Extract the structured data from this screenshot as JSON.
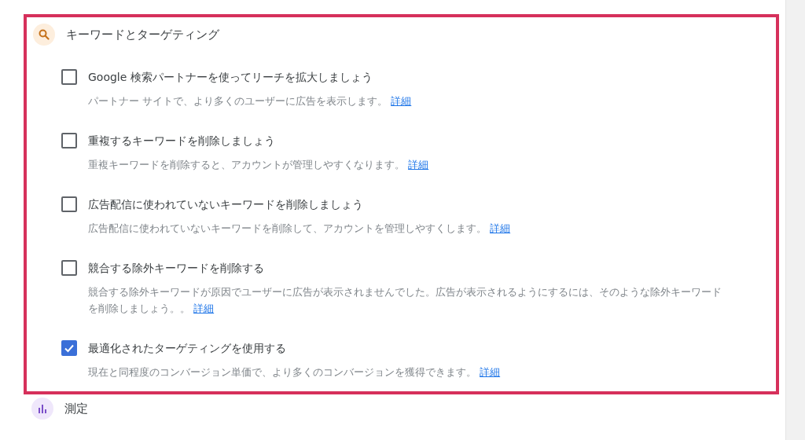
{
  "section": {
    "title": "キーワードとターゲティング"
  },
  "items": [
    {
      "title": "Google 検索パートナーを使ってリーチを拡大しましょう",
      "description": "パートナー サイトで、より多くのユーザーに広告を表示します。",
      "link": "詳細",
      "checked": false
    },
    {
      "title": "重複するキーワードを削除しましょう",
      "description": "重複キーワードを削除すると、アカウントが管理しやすくなります。",
      "link": "詳細",
      "checked": false
    },
    {
      "title": "広告配信に使われていないキーワードを削除しましょう",
      "description": "広告配信に使われていないキーワードを削除して、アカウントを管理しやすくします。",
      "link": "詳細",
      "checked": false
    },
    {
      "title": "競合する除外キーワードを削除する",
      "description": "競合する除外キーワードが原因でユーザーに広告が表示されませんでした。広告が表示されるようにするには、そのような除外キーワードを削除しましょう。。",
      "link": "詳細",
      "checked": false
    },
    {
      "title": "最適化されたターゲティングを使用する",
      "description": "現在と同程度のコンバージョン単価で、より多くのコンバージョンを獲得できます。",
      "link": "詳細",
      "checked": true
    }
  ],
  "next_section": {
    "title": "測定"
  }
}
